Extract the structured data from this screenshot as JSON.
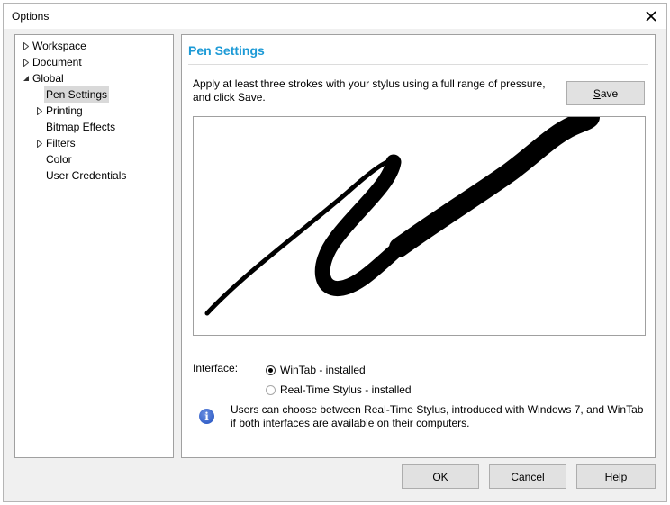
{
  "window": {
    "title": "Options"
  },
  "tree": {
    "items": [
      {
        "label": "Workspace",
        "arrow": "collapsed"
      },
      {
        "label": "Document",
        "arrow": "collapsed"
      },
      {
        "label": "Global",
        "arrow": "expanded"
      },
      {
        "label": "Pen Settings",
        "selected": true
      },
      {
        "label": "Printing",
        "arrow": "collapsed"
      },
      {
        "label": "Bitmap Effects"
      },
      {
        "label": "Filters",
        "arrow": "collapsed"
      },
      {
        "label": "Color"
      },
      {
        "label": "User Credentials"
      }
    ]
  },
  "panel": {
    "title": "Pen Settings",
    "instructions_line1": "Apply at least three strokes with your stylus using a full range of pressure,",
    "instructions_line2": "and click Save.",
    "save_label_mnemonic": "S",
    "save_label_rest": "ave",
    "interface_label": "Interface:",
    "radio_options": [
      {
        "label": "WinTab - installed",
        "checked": true
      },
      {
        "label": "Real-Time Stylus - installed",
        "checked": false
      }
    ],
    "info_line1": "Users can choose between Real-Time Stylus, introduced with Windows 7, and WinTab",
    "info_line2": "if both interfaces are available on their computers."
  },
  "footer": {
    "ok_label": "OK",
    "cancel_label": "Cancel",
    "help_label": "Help"
  },
  "colors": {
    "accent": "#1c9ad6",
    "dialog_bg": "#f0f0f0",
    "button_bg": "#e1e1e1"
  },
  "icons": {
    "close": "close-icon",
    "info": "info-icon",
    "expand": "triangle-right-icon",
    "collapse": "triangle-down-icon"
  }
}
